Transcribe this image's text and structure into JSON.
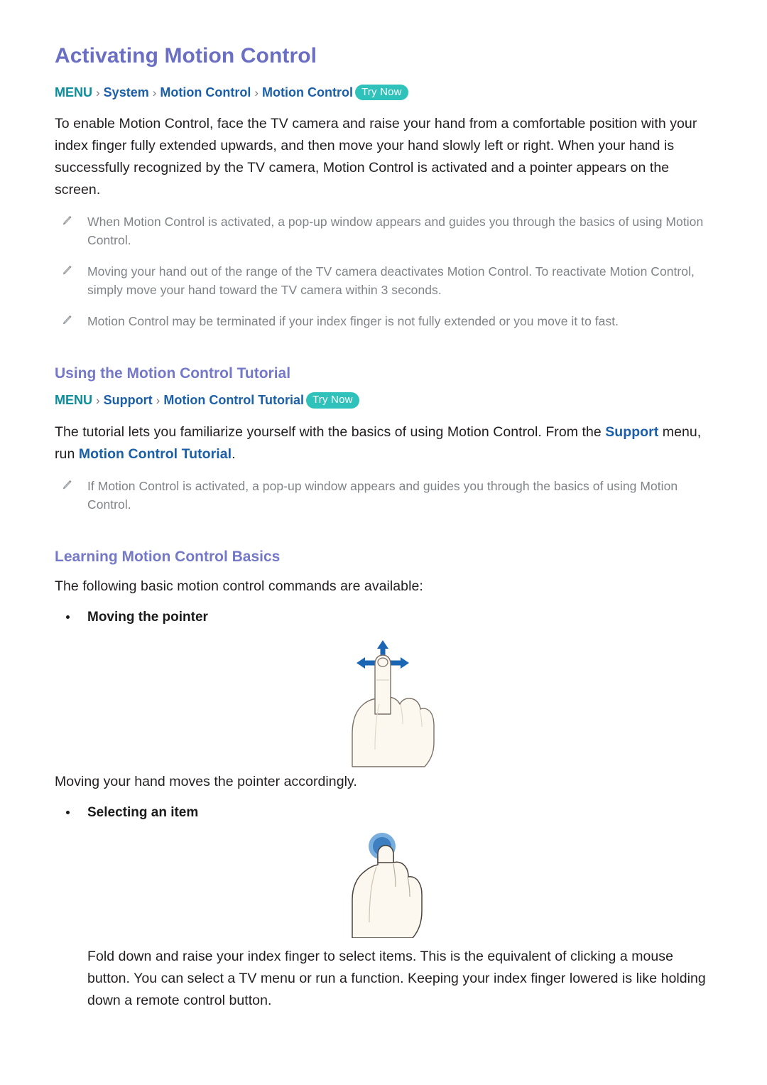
{
  "document": {
    "title": "Activating Motion Control"
  },
  "sections": [
    {
      "id": "activating-motion-control",
      "title": "Activating Motion Control",
      "breadcrumb": {
        "menu": "MENU",
        "separator": "›",
        "items": [
          "System",
          "Motion Control",
          "Motion Control"
        ],
        "badge": "Try Now"
      },
      "paragraph": "To enable Motion Control, face the TV camera and raise your hand from a comfortable position with your index finger fully extended upwards, and then move your hand slowly left or right. When your hand is successfully recognized by the TV camera, Motion Control is activated and a pointer appears on the screen.",
      "notes": [
        "When Motion Control is activated, a pop-up window appears and guides you through the basics of using Motion Control.",
        "Moving your hand out of the range of the TV camera deactivates Motion Control. To reactivate Motion Control, simply move your hand toward the TV camera within 3 seconds.",
        "Motion Control may be terminated if your index finger is not fully extended or you move it to fast."
      ]
    },
    {
      "id": "using-the-motion-control-tutorial",
      "title": "Using the Motion Control Tutorial",
      "breadcrumb": {
        "menu": "MENU",
        "separator": "›",
        "items": [
          "Support",
          "Motion Control Tutorial"
        ],
        "badge": "Try Now"
      },
      "paragraph_parts": {
        "lead": "The tutorial lets you familiarize yourself with the basics of using Motion Control. From the ",
        "link1": "Support",
        "middle": " menu, run ",
        "link2": "Motion Control Tutorial",
        "tail": "."
      },
      "notes": [
        "If Motion Control is activated, a pop-up window appears and guides you through the basics of using Motion Control."
      ]
    },
    {
      "id": "learning-motion-control-basics",
      "title": "Learning Motion Control Basics",
      "intro": "The following basic motion control commands are available:",
      "commands": [
        {
          "label": "Moving the pointer",
          "figure": "hand-pointing-with-four-way-arrows",
          "caption": "Moving your hand moves the pointer accordingly."
        },
        {
          "label": "Selecting an item",
          "figure": "hand-folded-finger-tap",
          "caption": "Fold down and raise your index finger to select items. This is the equivalent of clicking a mouse button. You can select a TV menu or run a function. Keeping your index finger lowered is like holding down a remote control button."
        }
      ]
    }
  ],
  "colors": {
    "title": "#6b6fc4",
    "section_title": "#7478c8",
    "breadcrumb_menu": "#0a8e9b",
    "breadcrumb_item": "#1a5fa8",
    "badge_background": "#2ec2bb",
    "badge_text": "#ffffff",
    "body_text": "#231f20",
    "note_text": "#7f8387",
    "link": "#1a5fa8",
    "arrow_blue": "#1a66b5",
    "tap_blue": "#4f97d2",
    "hand_fill": "#fcf8f0",
    "hand_stroke": "#7a7168"
  },
  "icons": {
    "note": "pencil-icon",
    "bullet": "bullet-dot-icon"
  }
}
